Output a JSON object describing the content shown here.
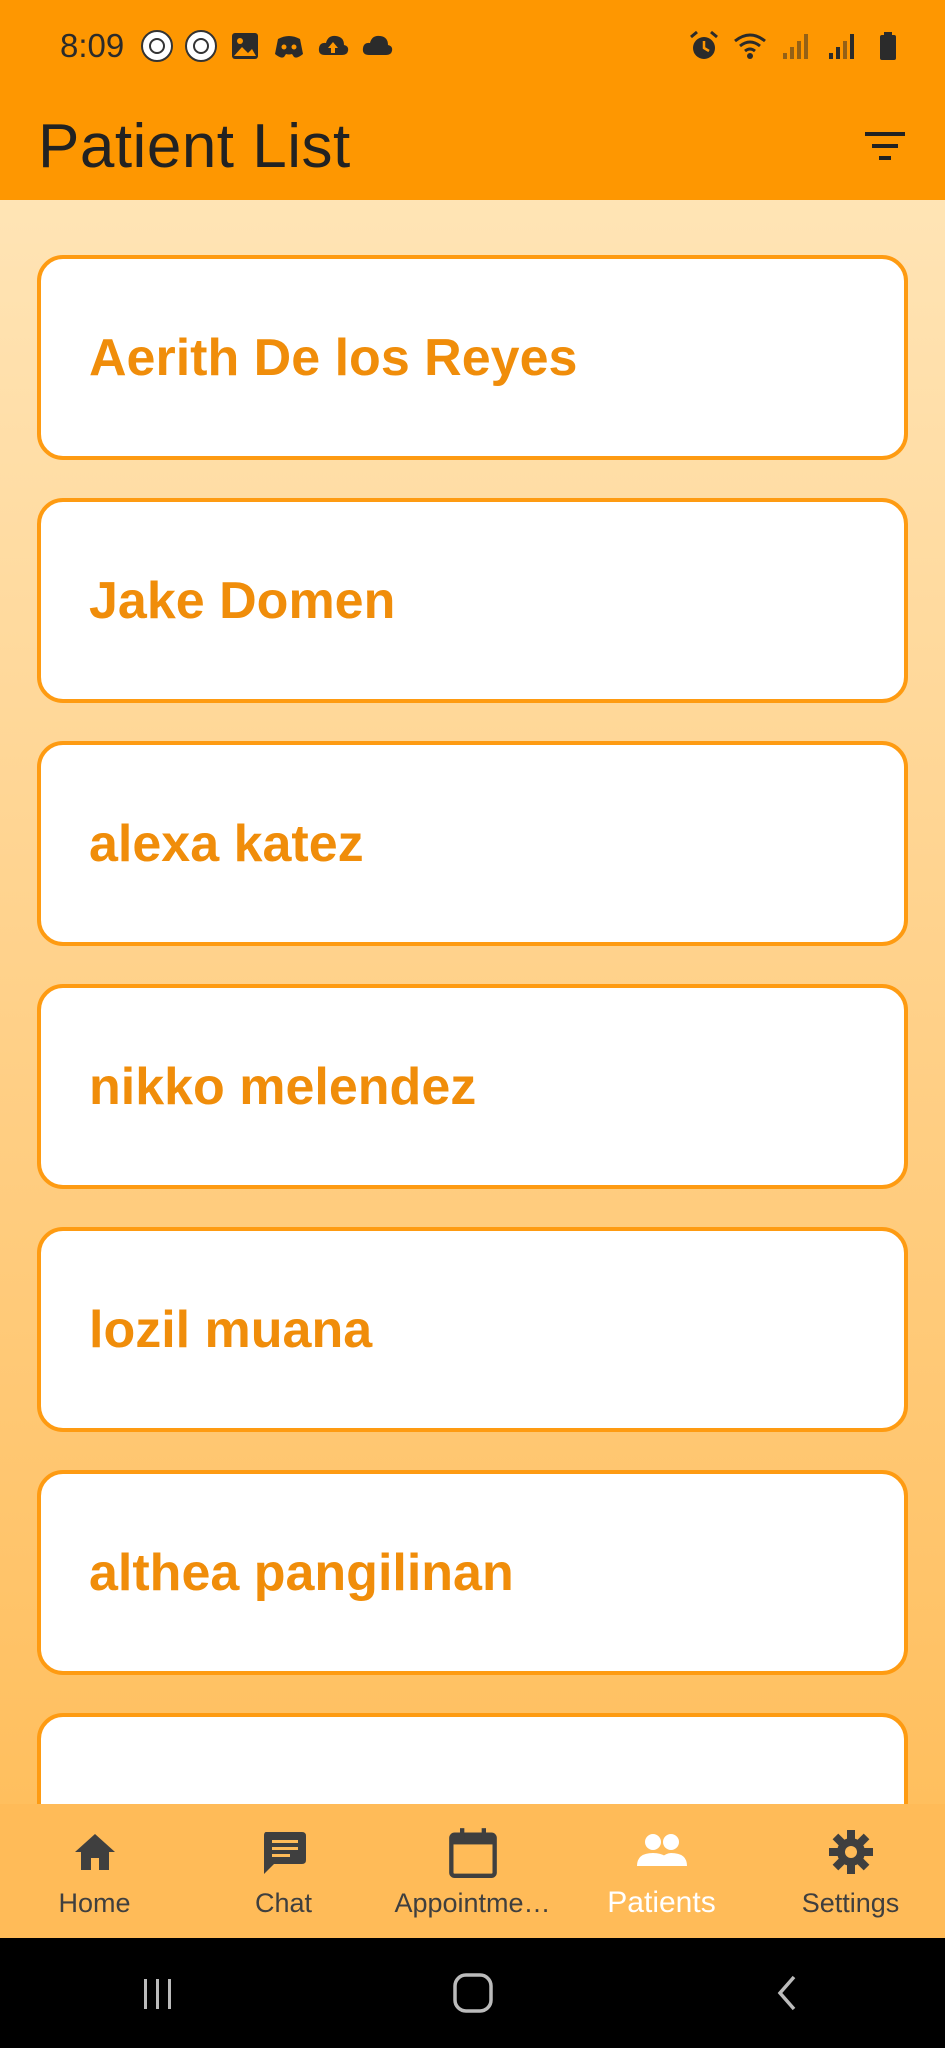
{
  "status_bar": {
    "time": "8:09",
    "left_icons": [
      "app-badge-icon",
      "app-badge-icon",
      "image-icon",
      "discord-icon",
      "cloud-upload-icon",
      "cloud-icon"
    ],
    "right_icons": [
      "alarm-icon",
      "wifi-icon",
      "signal-icon",
      "signal-icon",
      "battery-icon"
    ]
  },
  "app_bar": {
    "title": "Patient List",
    "filter_icon": "filter-icon"
  },
  "patients": [
    {
      "name": "Aerith De los Reyes"
    },
    {
      "name": "Jake Domen"
    },
    {
      "name": "alexa katez"
    },
    {
      "name": "nikko melendez"
    },
    {
      "name": "lozil muana"
    },
    {
      "name": "althea pangilinan"
    },
    {
      "name": ""
    }
  ],
  "bottom_nav": {
    "items": [
      {
        "label": "Home",
        "icon": "home-icon",
        "active": false
      },
      {
        "label": "Chat",
        "icon": "chat-icon",
        "active": false
      },
      {
        "label": "Appointme…",
        "icon": "calendar-icon",
        "active": false
      },
      {
        "label": "Patients",
        "icon": "people-icon",
        "active": true
      },
      {
        "label": "Settings",
        "icon": "gear-icon",
        "active": false
      }
    ]
  },
  "system_nav": {
    "items": [
      "recent-apps-icon",
      "home-circle-icon",
      "back-icon"
    ]
  },
  "colors": {
    "primary": "#fe9701",
    "card_border": "#fe9b12",
    "card_text": "#f08d0a",
    "nav_background": "#ffbb58",
    "active_nav": "#ffffff"
  }
}
